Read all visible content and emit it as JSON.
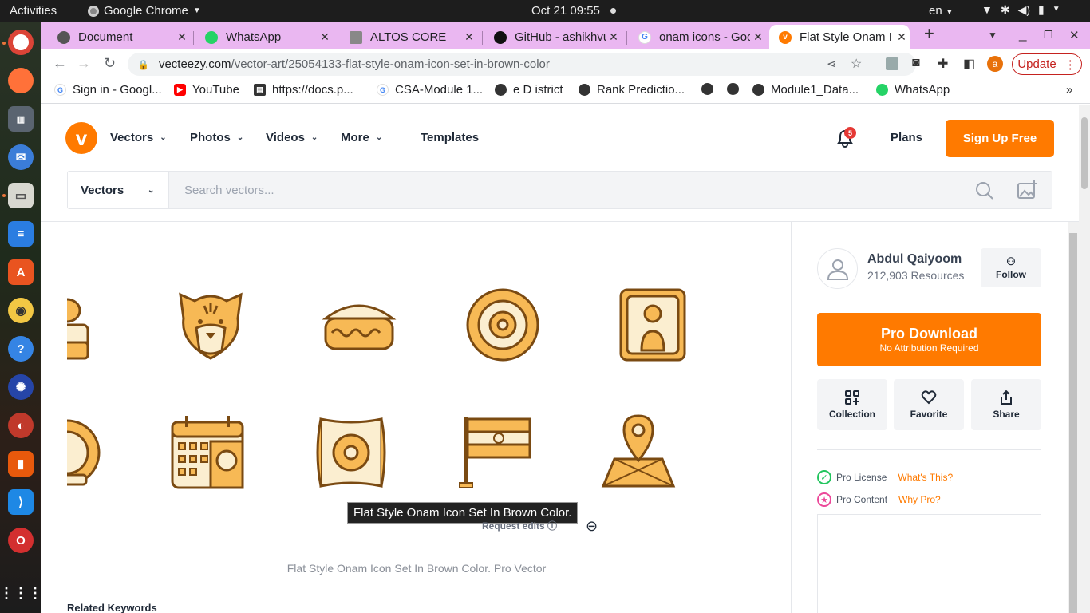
{
  "os": {
    "activities": "Activities",
    "app_name": "Google Chrome",
    "clock": "Oct 21  09:55",
    "lang": "en"
  },
  "tabs": [
    {
      "title": "Document",
      "icon": "globe-icon",
      "color": "#555555"
    },
    {
      "title": "WhatsApp",
      "icon": "whatsapp-icon",
      "color": "#25d366"
    },
    {
      "title": "ALTOS CORE",
      "icon": "chart-icon",
      "color": "#777777"
    },
    {
      "title": "GitHub - ashikhvu",
      "icon": "github-icon",
      "color": "#111111"
    },
    {
      "title": "onam icons - Goo",
      "icon": "google-icon",
      "color": "#4285f4"
    },
    {
      "title": "Flat Style Onam I",
      "icon": "vecteezy-icon",
      "color": "#ff7a00"
    }
  ],
  "address": {
    "domain": "vecteezy.com",
    "path": "/vector-art/25054133-flat-style-onam-icon-set-in-brown-color"
  },
  "update_label": "Update",
  "profile_initial": "a",
  "bookmarks": [
    {
      "label": "Sign in - Googl...",
      "icon": "google-icon",
      "color": "#4285f4"
    },
    {
      "label": "YouTube",
      "icon": "youtube-icon",
      "color": "#ff0000"
    },
    {
      "label": "https://docs.p...",
      "icon": "docs-icon",
      "color": "#333333"
    },
    {
      "label": "CSA-Module 1...",
      "icon": "google-icon",
      "color": "#4285f4"
    },
    {
      "label": "e D istrict",
      "icon": "globe-icon",
      "color": "#333333"
    },
    {
      "label": "Rank Predictio...",
      "icon": "globe-icon",
      "color": "#333333"
    },
    {
      "label": "",
      "icon": "globe-icon",
      "color": "#333333"
    },
    {
      "label": "",
      "icon": "globe-icon",
      "color": "#333333"
    },
    {
      "label": "Module1_Data...",
      "icon": "globe-icon",
      "color": "#333333"
    },
    {
      "label": "WhatsApp",
      "icon": "whatsapp-icon",
      "color": "#25d366"
    }
  ],
  "site": {
    "nav": [
      "Vectors",
      "Photos",
      "Videos",
      "More"
    ],
    "templates": "Templates",
    "notification_count": "5",
    "plans": "Plans",
    "signup": "Sign Up Free",
    "search_type": "Vectors",
    "search_placeholder": "Search vectors..."
  },
  "preview": {
    "tooltip": "Flat Style Onam Icon Set In Brown Color.",
    "request_edits": "Request edits",
    "caption": "Flat Style Onam Icon Set In Brown Color. Pro Vector",
    "related": "Related Keywords"
  },
  "sidebar": {
    "author": "Abdul Qaiyoom",
    "resources": "212,903 Resources",
    "follow": "Follow",
    "pro_download": "Pro Download",
    "pro_sub": "No Attribution Required",
    "actions": [
      "Collection",
      "Favorite",
      "Share"
    ],
    "license_label": "Pro License",
    "license_link": "What's This?",
    "content_label": "Pro Content",
    "content_link": "Why Pro?"
  },
  "colors": {
    "brand": "#ff7a00",
    "icon_fill": "#f7b955",
    "icon_stroke": "#7a4a12",
    "icon_cream": "#fbeed0"
  }
}
